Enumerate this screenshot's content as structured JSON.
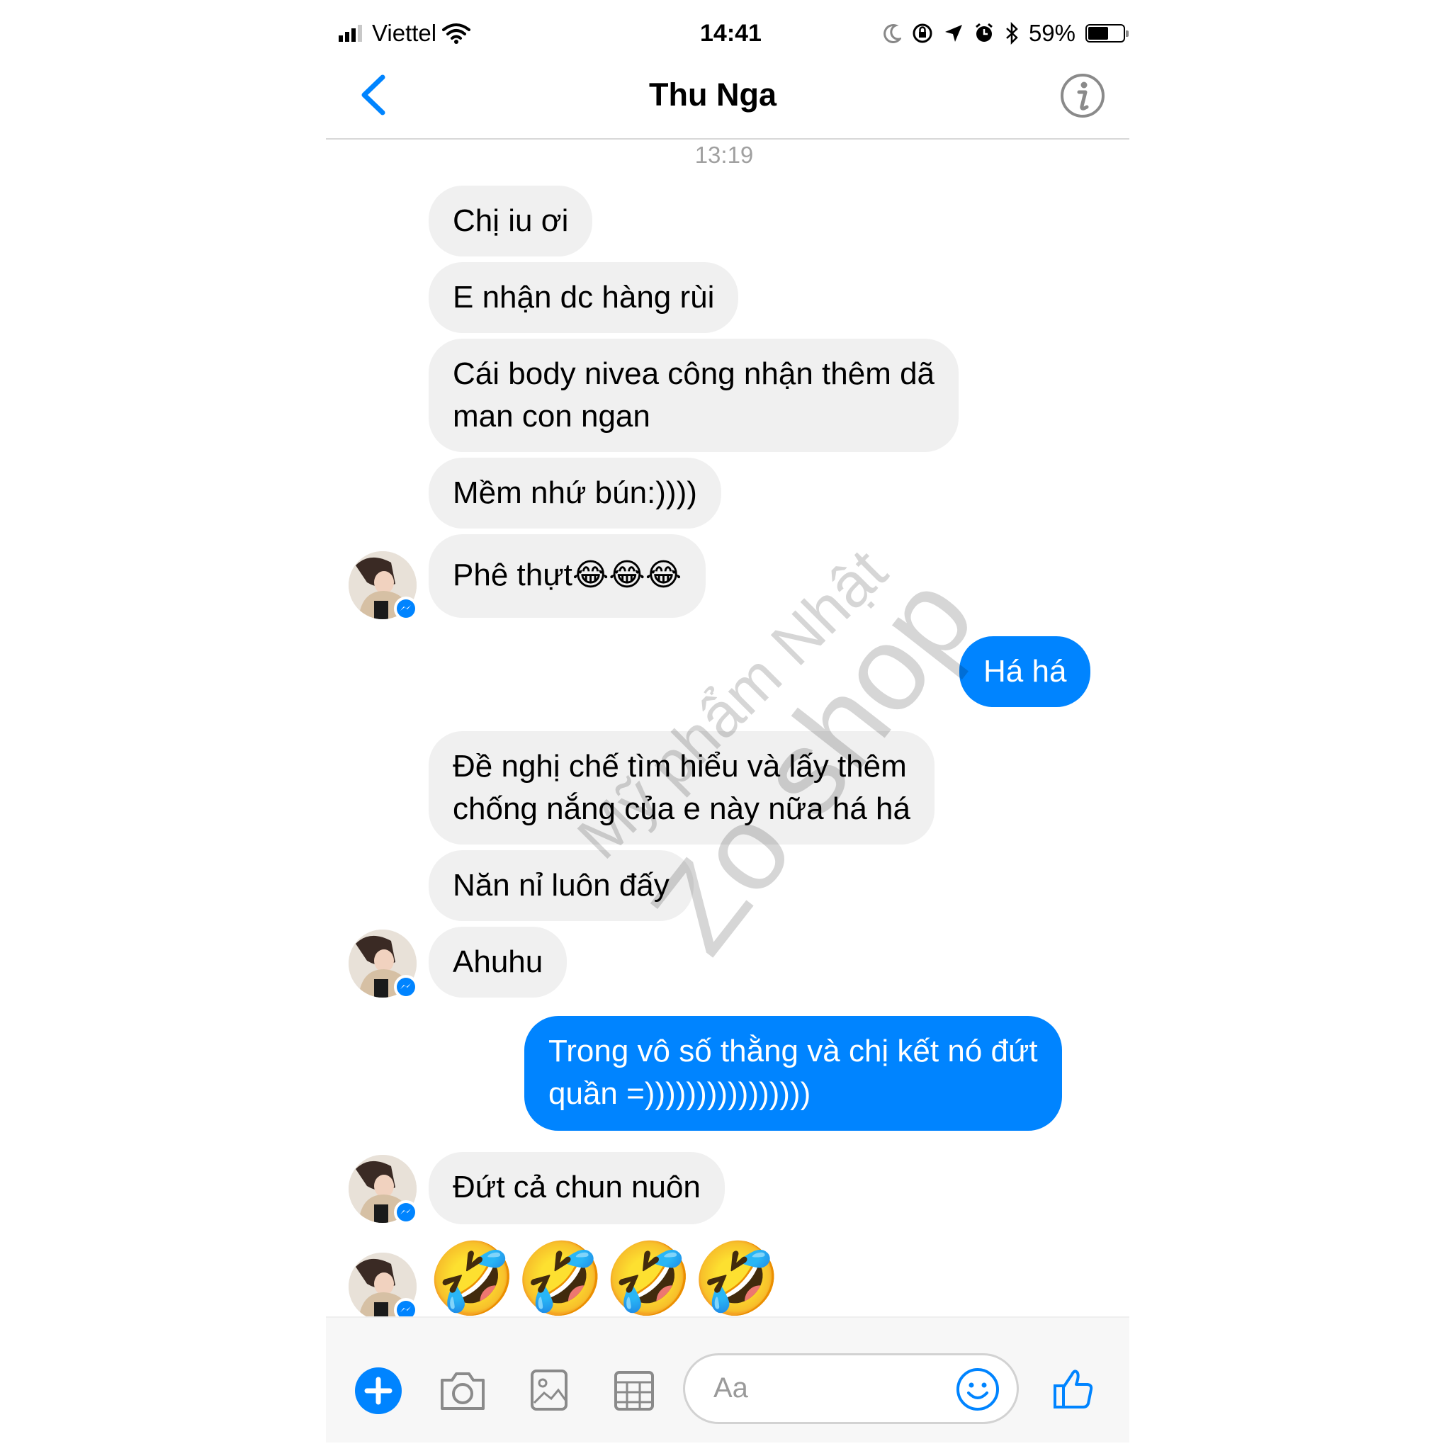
{
  "status_bar": {
    "carrier": "Viettel",
    "time": "14:41",
    "battery_percent": "59%",
    "battery_level": 0.59,
    "icons": [
      "signal-icon",
      "wifi-icon",
      "moon-icon",
      "rotation-lock-icon",
      "location-icon",
      "alarm-icon",
      "bluetooth-icon",
      "battery-icon"
    ]
  },
  "header": {
    "contact_name": "Thu Nga",
    "back_icon": "chevron-left-icon",
    "info_icon": "info-icon"
  },
  "conversation": {
    "timestamp": "13:19",
    "messages": [
      {
        "dir": "in",
        "text": "Chị iu ơi"
      },
      {
        "dir": "in",
        "text": "E nhận dc hàng rùi"
      },
      {
        "dir": "in",
        "lines": [
          "Cái body nivea công nhận thêm dã",
          "man con ngan"
        ]
      },
      {
        "dir": "in",
        "text": "Mềm nhứ bún:))))"
      },
      {
        "dir": "in",
        "text": "Phê thựt😂😂😂"
      },
      {
        "dir": "out",
        "text": "Há há"
      },
      {
        "dir": "in",
        "lines": [
          "Đề nghị chế tìm hiểu và lấy thêm",
          "chống nắng của e này nữa há há"
        ]
      },
      {
        "dir": "in",
        "text": "Năn nỉ luôn đấy"
      },
      {
        "dir": "in",
        "text": "Ahuhu"
      },
      {
        "dir": "out",
        "lines": [
          "Trong vô số thằng và chị kết nó đứt",
          "quần =))))))))))))))))"
        ]
      },
      {
        "dir": "in",
        "text": "Đứt cả chun nuôn"
      },
      {
        "dir": "in",
        "text": "🤣🤣🤣🤣"
      }
    ]
  },
  "watermark": {
    "line1": "Mỹ phẩm Nhật",
    "line2": "Zo shop"
  },
  "composer": {
    "placeholder": "Aa",
    "icons": [
      "plus-icon",
      "camera-icon",
      "image-icon",
      "grid-icon",
      "emoji-icon",
      "thumbs-up-icon"
    ]
  },
  "colors": {
    "accent": "#0084ff",
    "incoming_bubble": "#f0f0f0",
    "outgoing_text": "#ffffff",
    "timestamp": "#a0a0a0"
  }
}
